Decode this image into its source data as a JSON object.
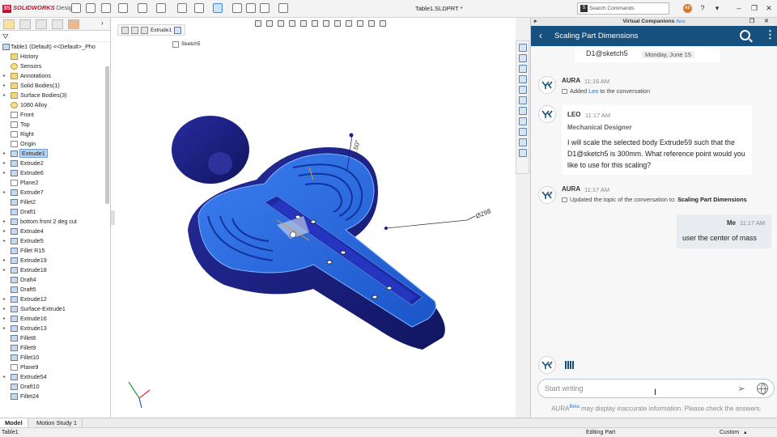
{
  "app": {
    "logo_brand": "SOLIDWORKS",
    "logo_edition": "Design",
    "document_title": "Table1.SLDPRT *",
    "search_placeholder": "Search Commands",
    "user_initials": "AB"
  },
  "feature_tree": {
    "root": "Table1 (Default) <<Default>_Pho",
    "items": [
      {
        "label": "History",
        "icon": "history-icon",
        "arrow": false
      },
      {
        "label": "Sensors",
        "icon": "sensor-icon",
        "arrow": false
      },
      {
        "label": "Annotations",
        "icon": "annotation-icon",
        "arrow": true
      },
      {
        "label": "Solid Bodies(1)",
        "icon": "folder-icon",
        "arrow": true
      },
      {
        "label": "Surface Bodies(3)",
        "icon": "folder-icon",
        "arrow": true
      },
      {
        "label": "1060 Alloy",
        "icon": "material-icon",
        "arrow": false
      },
      {
        "label": "Front",
        "icon": "plane-icon",
        "arrow": false
      },
      {
        "label": "Top",
        "icon": "plane-icon",
        "arrow": false
      },
      {
        "label": "Right",
        "icon": "plane-icon",
        "arrow": false
      },
      {
        "label": "Origin",
        "icon": "origin-icon",
        "arrow": false
      },
      {
        "label": "Extrude1",
        "icon": "extrude-icon",
        "arrow": true,
        "selected": true
      },
      {
        "label": "Extrude2",
        "icon": "extrude-icon",
        "arrow": true
      },
      {
        "label": "Extrude6",
        "icon": "extrude-icon",
        "arrow": true
      },
      {
        "label": "Plane2",
        "icon": "plane-icon",
        "arrow": false
      },
      {
        "label": "Extrude7",
        "icon": "extrude-icon",
        "arrow": true
      },
      {
        "label": "Fillet2",
        "icon": "fillet-icon",
        "arrow": false
      },
      {
        "label": "Draft1",
        "icon": "draft-icon",
        "arrow": false
      },
      {
        "label": "bottom front 2 deg cut",
        "icon": "cut-icon",
        "arrow": true
      },
      {
        "label": "Extrude4",
        "icon": "extrude-icon",
        "arrow": true
      },
      {
        "label": "Extrude5",
        "icon": "extrude-icon",
        "arrow": true
      },
      {
        "label": "Fillet R15",
        "icon": "fillet-icon",
        "arrow": false
      },
      {
        "label": "Extrude19",
        "icon": "extrude-icon",
        "arrow": true
      },
      {
        "label": "Extrude18",
        "icon": "extrude-icon",
        "arrow": true
      },
      {
        "label": "Draft4",
        "icon": "draft-icon",
        "arrow": false
      },
      {
        "label": "Draft5",
        "icon": "draft-icon",
        "arrow": false
      },
      {
        "label": "Extrude12",
        "icon": "extrude-icon",
        "arrow": true
      },
      {
        "label": "Surface-Extrude1",
        "icon": "surface-extrude-icon",
        "arrow": true
      },
      {
        "label": "Extrude16",
        "icon": "extrude-icon",
        "arrow": true
      },
      {
        "label": "Extrude13",
        "icon": "extrude-icon",
        "arrow": true
      },
      {
        "label": "Fillet8",
        "icon": "fillet-icon",
        "arrow": false
      },
      {
        "label": "Fillet9",
        "icon": "fillet-icon",
        "arrow": false
      },
      {
        "label": "Fillet10",
        "icon": "fillet-icon",
        "arrow": false
      },
      {
        "label": "Plane9",
        "icon": "plane-icon",
        "arrow": false
      },
      {
        "label": "Extrude54",
        "icon": "extrude-icon",
        "arrow": true
      },
      {
        "label": "Draft10",
        "icon": "draft-icon",
        "arrow": false
      },
      {
        "label": "Fillet24",
        "icon": "fillet-icon",
        "arrow": false
      }
    ]
  },
  "viewport": {
    "breadcrumb_feature": "Extrude1",
    "breadcrumb_sketch": "Sketch5",
    "dimension_angle": "2.50°",
    "dimension_diameter": "Ø298"
  },
  "bottom_tabs": [
    {
      "label": "Model",
      "active": true
    },
    {
      "label": "Motion Study 1",
      "active": false
    }
  ],
  "status": {
    "left": "Table1",
    "mode": "Editing Part",
    "units": "Custom"
  },
  "chat": {
    "window_title": "Virtual Companions",
    "window_title_beta": "Beta",
    "topic": "Scaling Part Dimensions",
    "previous_snippet": "D1@sketch5",
    "previous_date": "Monday, June 15",
    "messages": [
      {
        "sender": "AURA",
        "time": "11:16 AM",
        "text_prefix": "Added ",
        "text_link": "Leo",
        "text_suffix": " to the conversation"
      },
      {
        "sender": "LEO",
        "time": "11:17 AM",
        "role": "Mechanical Designer",
        "text": "I will scale the selected body Extrude59 such that the D1@sketch5 is 300mm. What reference point would you like to use for this scaling?"
      },
      {
        "sender": "AURA",
        "time": "11:17 AM",
        "text_prefix": "Updated the topic of the conversation to: ",
        "text_bold": "Scaling Part Dimensions"
      },
      {
        "sender": "Me",
        "time": "11:17 AM",
        "text": "user the center of mass"
      }
    ],
    "input_placeholder": "Start writing",
    "disclaimer_name": "AURA",
    "disclaimer_beta": "Beta",
    "disclaimer_text": " may display inaccurate information. Please check the answers."
  },
  "colors": {
    "accent": "#16507f",
    "model_blue": "#1f5fd6",
    "model_dark": "#1a1f8a",
    "brand_red": "#c8102e"
  }
}
